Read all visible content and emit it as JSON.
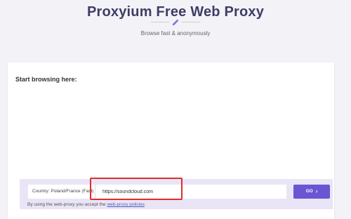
{
  "header": {
    "title": "Proxyium Free Web Proxy",
    "subtitle": "Browse fast & anonymously"
  },
  "main": {
    "heading": "Start browsing here:",
    "country_select": {
      "selected": "Country: Poland/France (Fast)"
    },
    "url_input": {
      "value": "https://soundcloud.com",
      "placeholder": ""
    },
    "go_button": {
      "label": "GO",
      "icon": "chevron-right-icon"
    },
    "terms": {
      "prefix": "By using the web-proxy you accept the",
      "link": "web-proxy policies"
    }
  },
  "colors": {
    "accent": "#6a55d3",
    "title": "#3f3d66",
    "highlight": "#e02d2d"
  }
}
